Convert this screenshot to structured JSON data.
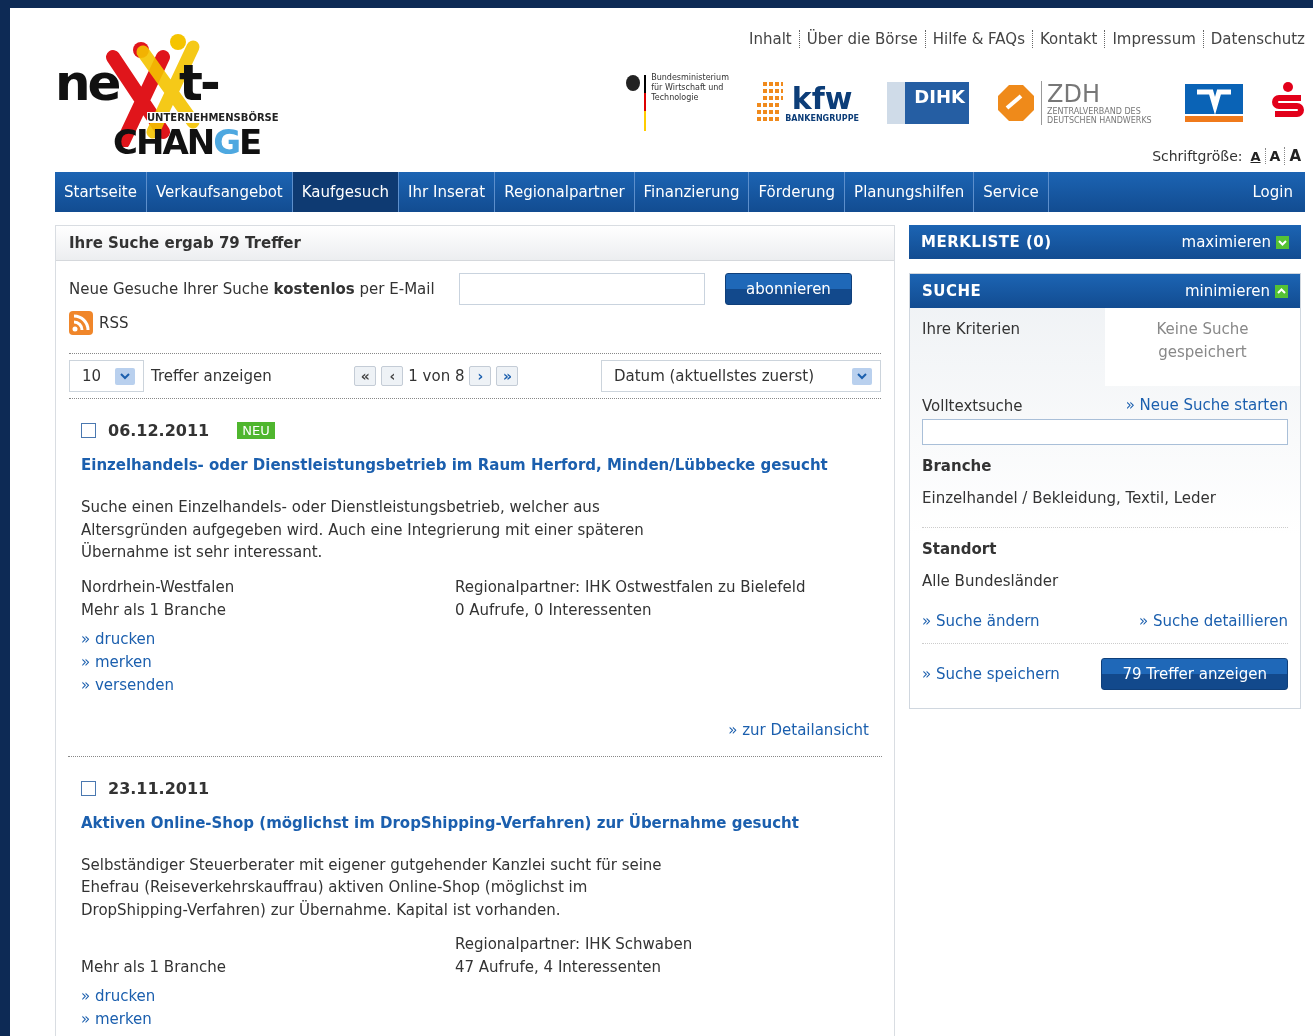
{
  "top_links": [
    "Inhalt",
    "Über die Börse",
    "Hilfe & FAQs",
    "Kontakt",
    "Impressum",
    "Datenschutz"
  ],
  "brand": {
    "word_start": "ne",
    "word_end": "t-",
    "tagline": "UNTERNEHMENSBÖRSE",
    "word_change": "CHAN",
    "word_g": "G",
    "word_e": "E"
  },
  "partner_logos": [
    {
      "kind": "ministry",
      "text": "Bundesministerium für Wirtschaft und Technologie"
    },
    {
      "kind": "kfw",
      "text": "kfw",
      "subtext": "BANKENGRUPPE"
    },
    {
      "kind": "dihk",
      "text": "DIHK"
    },
    {
      "kind": "zdh",
      "text": "ZDH",
      "subtext": "ZENTRALVERBAND DES DEUTSCHEN HANDWERKS"
    },
    {
      "kind": "vr"
    },
    {
      "kind": "sparkasse"
    }
  ],
  "font_size": {
    "label": "Schriftgröße:",
    "options": [
      {
        "label": "A",
        "selected": true
      },
      {
        "label": "A",
        "selected": false
      },
      {
        "label": "A",
        "selected": false
      }
    ]
  },
  "nav": {
    "items": [
      {
        "label": "Startseite",
        "selected": false
      },
      {
        "label": "Verkaufsangebot",
        "selected": false
      },
      {
        "label": "Kaufgesuch",
        "selected": true
      },
      {
        "label": "Ihr Inserat",
        "selected": false
      },
      {
        "label": "Regionalpartner",
        "selected": false
      },
      {
        "label": "Finanzierung",
        "selected": false
      },
      {
        "label": "Förderung",
        "selected": false
      },
      {
        "label": "Planungshilfen",
        "selected": false
      },
      {
        "label": "Service",
        "selected": false
      }
    ],
    "login": "Login"
  },
  "results": {
    "title": "Ihre Suche ergab 79 Treffer",
    "subscribe": {
      "text": "Neue Gesuche Ihrer Suche **kostenlos** per E-Mail",
      "button": "abonnieren"
    },
    "rss": "RSS",
    "per_page": {
      "value": "10",
      "label": "Treffer anzeigen"
    },
    "pager": {
      "first": "«",
      "prev": "‹",
      "status": "1 von 8",
      "next": "›",
      "last": "»"
    },
    "sort": {
      "value": "Datum (aktuellstes zuerst)"
    },
    "listings": [
      {
        "checked": false,
        "date": "06.12.2011",
        "badge": "NEU",
        "title": "Einzelhandels- oder Dienstleistungsbetrieb im Raum Herford, Minden/Lübbecke gesucht",
        "description": "Suche einen Einzelhandels- oder Dienstleistungsbetrieb, welcher aus Altersgründen aufgegeben wird. Auch eine Integrierung mit einer späteren Übernahme ist sehr interessant.",
        "details": [
          {
            "left": "Nordrhein-Westfalen",
            "right": "Regionalpartner: IHK Ostwestfalen zu Bielefeld"
          },
          {
            "left": "Mehr als 1 Branche",
            "right": "0 Aufrufe, 0 Interessenten"
          }
        ],
        "actions": [
          "» drucken",
          "» merken",
          "» versenden"
        ],
        "detail_link": "» zur Detailansicht"
      },
      {
        "checked": false,
        "date": "23.11.2011",
        "title": "Aktiven Online-Shop (möglichst im DropShipping-Verfahren) zur Übernahme gesucht",
        "description": "Selbständiger Steuerberater mit eigener gutgehender Kanzlei sucht für seine Ehefrau (Reiseverkehrskauffrau) aktiven Online-Shop (möglichst im DropShipping-Verfahren) zur Übernahme. Kapital ist vorhanden.",
        "details": [
          {
            "right": "Regionalpartner: IHK Schwaben"
          },
          {
            "left": "Mehr als 1 Branche",
            "right": "47 Aufrufe, 4 Interessenten"
          }
        ],
        "actions": [
          "» drucken",
          "» merken"
        ]
      }
    ]
  },
  "merkliste": {
    "title": "MERKLISTE (0)",
    "toggle": "maximieren",
    "expanded": false
  },
  "suche": {
    "title": "SUCHE",
    "toggle": "minimieren",
    "expanded": true,
    "tabs": [
      {
        "label": "Ihre Kriterien",
        "selected": true
      },
      {
        "label": "Keine Suche gespeichert",
        "selected": false
      }
    ],
    "fulltext_label": "Volltextsuche",
    "new_search": "» Neue Suche starten",
    "criteria": [
      {
        "heading": "Branche",
        "value": "Einzelhandel / Bekleidung, Textil, Leder"
      },
      {
        "heading": "Standort",
        "value": "Alle Bundesländer"
      }
    ],
    "change": "» Suche ändern",
    "refine": "» Suche detaillieren",
    "save": "» Suche speichern",
    "show_button": "79 Treffer anzeigen"
  }
}
